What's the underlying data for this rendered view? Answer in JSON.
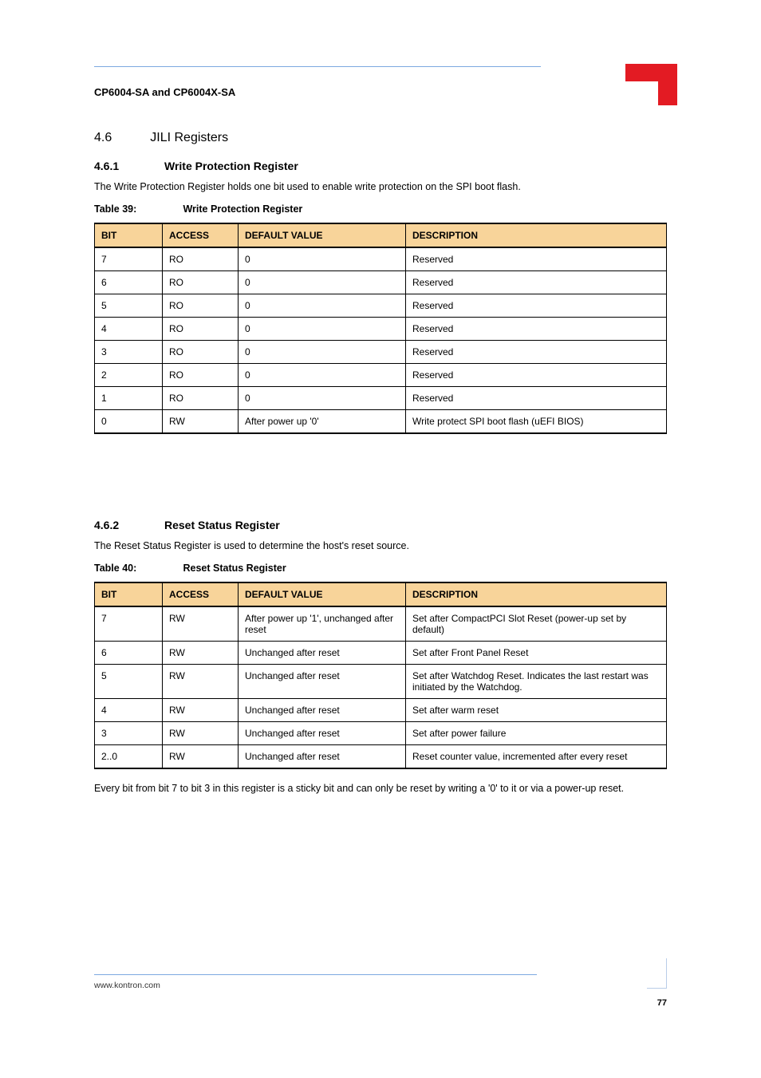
{
  "runningHead": "CP6004-SA and CP6004X-SA",
  "section": {
    "num": "4.6",
    "title": "JILI Registers"
  },
  "sub1": {
    "num": "4.6.1",
    "title": "Write Protection Register",
    "para": "The Write Protection Register holds one bit used to enable write protection on the SPI boot flash.",
    "tableCap": {
      "prefix": "Table 39:",
      "title": "Write Protection Register"
    },
    "headers": [
      "BIT",
      "ACCESS",
      "DEFAULT VALUE",
      "DESCRIPTION"
    ],
    "rows": [
      {
        "bit": "7",
        "access": "RO",
        "def": "0",
        "desc": "Reserved"
      },
      {
        "bit": "6",
        "access": "RO",
        "def": "0",
        "desc": "Reserved"
      },
      {
        "bit": "5",
        "access": "RO",
        "def": "0",
        "desc": "Reserved"
      },
      {
        "bit": "4",
        "access": "RO",
        "def": "0",
        "desc": "Reserved"
      },
      {
        "bit": "3",
        "access": "RO",
        "def": "0",
        "desc": "Reserved"
      },
      {
        "bit": "2",
        "access": "RO",
        "def": "0",
        "desc": "Reserved"
      },
      {
        "bit": "1",
        "access": "RO",
        "def": "0",
        "desc": "Reserved"
      },
      {
        "bit": "0",
        "access": "RW",
        "def": "After power up '0'",
        "desc": "Write protect SPI boot flash (uEFI BIOS)"
      }
    ]
  },
  "sub2": {
    "num": "4.6.2",
    "title": "Reset Status Register",
    "para": "The Reset Status Register is used to determine the host's reset source.",
    "tableCap": {
      "prefix": "Table 40:",
      "title": "Reset Status Register"
    },
    "headers": [
      "BIT",
      "ACCESS",
      "DEFAULT VALUE",
      "DESCRIPTION"
    ],
    "rows": [
      {
        "bit": "7",
        "access": "RW",
        "def": "After power up '1', unchanged after reset",
        "desc": "Set after CompactPCI Slot Reset (power-up set by default)"
      },
      {
        "bit": "6",
        "access": "RW",
        "def": "Unchanged after reset",
        "desc": "Set after Front Panel Reset"
      },
      {
        "bit": "5",
        "access": "RW",
        "def": "Unchanged after reset",
        "desc": "Set after Watchdog Reset. Indicates the last restart was initiated by the Watchdog."
      },
      {
        "bit": "4",
        "access": "RW",
        "def": "Unchanged after reset",
        "desc": "Set after warm reset"
      },
      {
        "bit": "3",
        "access": "RW",
        "def": "Unchanged after reset",
        "desc": "Set after power failure"
      },
      {
        "bit": "2..0",
        "access": "RW",
        "def": "Unchanged after reset",
        "desc": "Reset counter value, incremented after every reset"
      }
    ],
    "note": "Every bit from bit 7 to bit 3 in this register is a sticky bit and can only be reset by writing a '0' to it or via a power-up reset."
  },
  "footer": {
    "left": "www.kontron.com",
    "right": "",
    "page": "77"
  }
}
